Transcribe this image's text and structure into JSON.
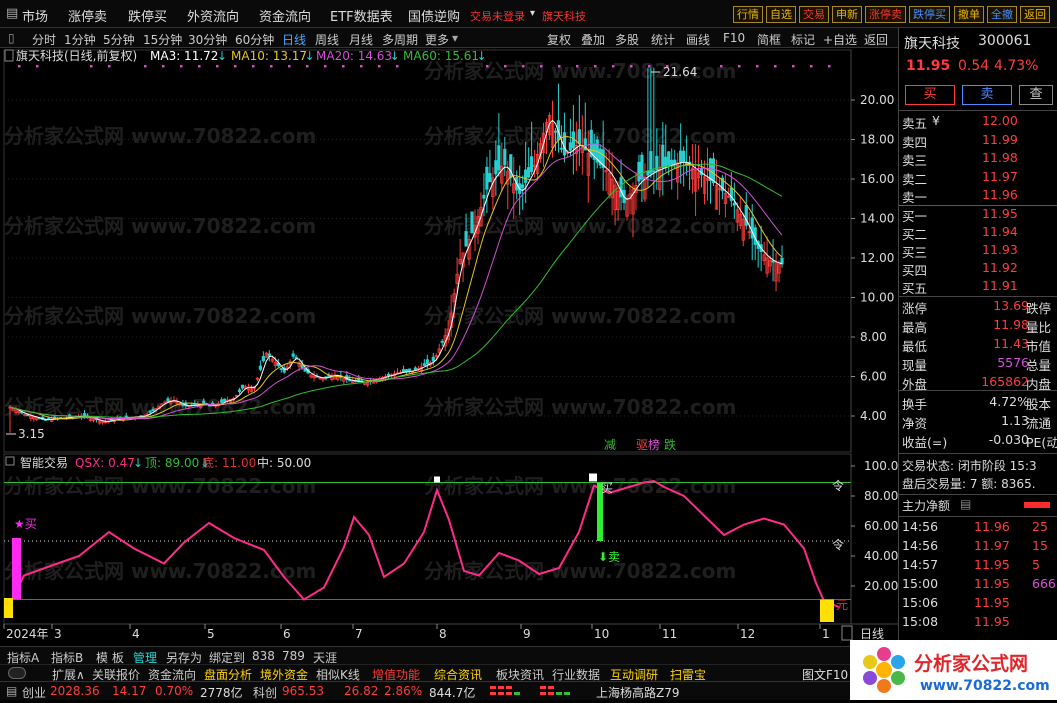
{
  "menu": {
    "items": [
      "市场",
      "涨停卖",
      "跌停买",
      "外资流向",
      "资金流向",
      "ETF数据表",
      "国债逆购"
    ],
    "login_warning": "交易未登录",
    "stock_tag": "旗天科技"
  },
  "right_buttons": [
    {
      "label": "行情",
      "color": "gold"
    },
    {
      "label": "自选",
      "color": "gold"
    },
    {
      "label": "交易",
      "color": "red"
    },
    {
      "label": "申新",
      "color": "gold"
    },
    {
      "label": "涨停卖",
      "color": "red"
    },
    {
      "label": "跌停买",
      "color": "blue"
    },
    {
      "label": "撤单",
      "color": "gold"
    },
    {
      "label": "全撤",
      "color": "blue"
    },
    {
      "label": "返回",
      "color": "gold"
    }
  ],
  "toolbar": {
    "periods": [
      "分时",
      "1分钟",
      "5分钟",
      "15分钟",
      "30分钟",
      "60分钟",
      "日线",
      "周线",
      "月线",
      "多周期",
      "更多"
    ],
    "active_period": "日线",
    "tools": [
      "复权",
      "叠加",
      "多股",
      "统计",
      "画线",
      "F10",
      "简框",
      "标记",
      "+自选",
      "返回"
    ]
  },
  "main_chart": {
    "title": "旗天科技(日线,前复权)",
    "ma": [
      {
        "label": "MA3: 11.72",
        "arrow": "↓",
        "color": "#ffffff"
      },
      {
        "label": "MA10: 13.17",
        "arrow": "↓",
        "color": "#e6c619"
      },
      {
        "label": "MA20: 14.63",
        "arrow": "↓",
        "color": "#d64fd6"
      },
      {
        "label": "MA60: 15.61",
        "arrow": "↓",
        "color": "#2fbf2f"
      }
    ],
    "y_ticks": [
      "20.00",
      "18.00",
      "16.00",
      "14.00",
      "12.00",
      "10.00",
      "8.00",
      "6.00",
      "4.00"
    ],
    "high_label": "21.64",
    "low_label": "3.15",
    "markers": {
      "jian": "减",
      "qu": "驱",
      "bang": "榜",
      "die": "跌"
    },
    "watermark": "分析家公式网 www.70822.com"
  },
  "indicator": {
    "title": "智能交易",
    "qsx": "QSX: 0.47",
    "qsx_arrow": "↓",
    "top": "顶: 89.00",
    "top_arrow": "↓",
    "bottom": "底: 11.00",
    "mid": "中: 50.00",
    "y_ticks": [
      "100.0",
      "80.00",
      "60.00",
      "40.00",
      "20.00"
    ],
    "buy_label": "★买",
    "buy2": "买",
    "sell_label": "卖",
    "ling1": "令",
    "ling2": "令",
    "yuan": "元"
  },
  "x_axis": {
    "labels": [
      "2024年",
      "3",
      "4",
      "5",
      "6",
      "7",
      "8",
      "9",
      "10",
      "11",
      "12",
      "1"
    ],
    "period": "日线"
  },
  "quote": {
    "name": "旗天科技",
    "code": "300061",
    "price": "11.95",
    "change": "0.54",
    "pct": "4.73%",
    "buy_btn": "买",
    "sell_btn": "卖",
    "more_btn": "查",
    "asks": [
      {
        "label": "卖五",
        "extra": "¥",
        "price": "12.00"
      },
      {
        "label": "卖四",
        "extra": "",
        "price": "11.99"
      },
      {
        "label": "卖三",
        "extra": "",
        "price": "11.98"
      },
      {
        "label": "卖二",
        "extra": "",
        "price": "11.97"
      },
      {
        "label": "卖一",
        "extra": "",
        "price": "11.96"
      }
    ],
    "bids": [
      {
        "label": "买一",
        "price": "11.95"
      },
      {
        "label": "买二",
        "price": "11.94"
      },
      {
        "label": "买三",
        "price": "11.93"
      },
      {
        "label": "买四",
        "price": "11.92"
      },
      {
        "label": "买五",
        "price": "11.91"
      }
    ],
    "stats": [
      {
        "k": "涨停",
        "v": "13.69",
        "k2": "跌停",
        "c": "#ff3b3b"
      },
      {
        "k": "最高",
        "v": "11.98",
        "k2": "量比",
        "c": "#ff3b3b"
      },
      {
        "k": "最低",
        "v": "11.43",
        "k2": "市值",
        "c": "#ff3b3b"
      },
      {
        "k": "现量",
        "v": "5576",
        "k2": "总量",
        "c": "#d64fd6"
      },
      {
        "k": "外盘",
        "v": "165862",
        "k2": "内盘",
        "c": "#ff3b3b"
      }
    ],
    "stats2": [
      {
        "k": "换手",
        "v": "4.72%",
        "k2": "股本"
      },
      {
        "k": "净资",
        "v": "1.13",
        "k2": "流通"
      },
      {
        "k": "收益(=)",
        "v": "-0.030",
        "k2": "PE(动"
      }
    ],
    "trade_state": "交易状态: 闭市阶段 15:3",
    "after_volume": "盘后交易量: 7  额: 8365.",
    "main_net": "主力净额",
    "ticks": [
      {
        "time": "14:56",
        "price": "11.96",
        "vol": "25"
      },
      {
        "time": "14:56",
        "price": "11.97",
        "vol": "15"
      },
      {
        "time": "14:57",
        "price": "11.95",
        "vol": "5"
      },
      {
        "time": "15:00",
        "price": "11.95",
        "vol": "666"
      },
      {
        "time": "15:06",
        "price": "11.95",
        "vol": ""
      },
      {
        "time": "15:08",
        "price": "11.95",
        "vol": ""
      }
    ]
  },
  "bottom_tabs": [
    "指标A",
    "指标B",
    "模 板",
    "管理",
    "另存为",
    "绑定到",
    "838",
    "789",
    "天涯"
  ],
  "bottom_tabs2": [
    "扩展∧",
    "关联报价",
    "资金流向",
    "盘面分析",
    "境外资金",
    "相似K线",
    "增值功能",
    "综合资讯",
    "板块资讯",
    "行业数据",
    "互动调研",
    "扫雷宝"
  ],
  "status": {
    "index_name": "创业",
    "index_val": "2028.36",
    "index_chg": "14.17",
    "index_pct": "0.70%",
    "index_amt": "2778亿",
    "kc_name": "科创",
    "kc_val": "965.53",
    "kc_chg": "26.82",
    "kc_pct": "2.86%",
    "kc_amt": "844.7亿",
    "location": "上海杨高路Z79",
    "f10": "图文F10"
  },
  "logo": {
    "text": "分析家公式网",
    "url": "www.70822.com"
  }
}
